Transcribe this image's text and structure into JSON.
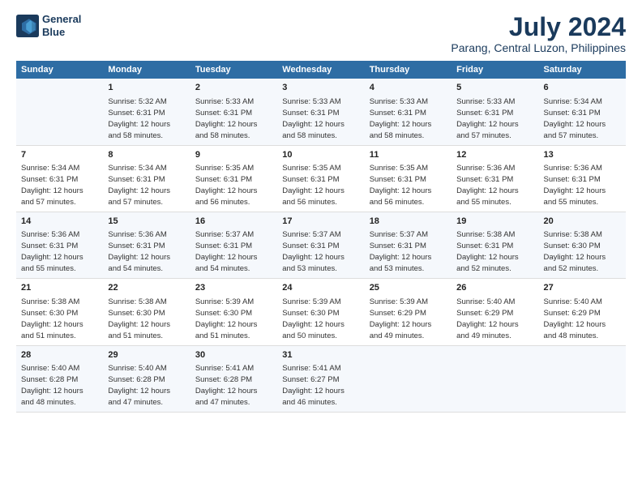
{
  "header": {
    "logo_line1": "General",
    "logo_line2": "Blue",
    "title": "July 2024",
    "subtitle": "Parang, Central Luzon, Philippines"
  },
  "columns": [
    "Sunday",
    "Monday",
    "Tuesday",
    "Wednesday",
    "Thursday",
    "Friday",
    "Saturday"
  ],
  "weeks": [
    {
      "cells": [
        {
          "day": "",
          "info": ""
        },
        {
          "day": "1",
          "info": "Sunrise: 5:32 AM\nSunset: 6:31 PM\nDaylight: 12 hours\nand 58 minutes."
        },
        {
          "day": "2",
          "info": "Sunrise: 5:33 AM\nSunset: 6:31 PM\nDaylight: 12 hours\nand 58 minutes."
        },
        {
          "day": "3",
          "info": "Sunrise: 5:33 AM\nSunset: 6:31 PM\nDaylight: 12 hours\nand 58 minutes."
        },
        {
          "day": "4",
          "info": "Sunrise: 5:33 AM\nSunset: 6:31 PM\nDaylight: 12 hours\nand 58 minutes."
        },
        {
          "day": "5",
          "info": "Sunrise: 5:33 AM\nSunset: 6:31 PM\nDaylight: 12 hours\nand 57 minutes."
        },
        {
          "day": "6",
          "info": "Sunrise: 5:34 AM\nSunset: 6:31 PM\nDaylight: 12 hours\nand 57 minutes."
        }
      ]
    },
    {
      "cells": [
        {
          "day": "7",
          "info": "Sunrise: 5:34 AM\nSunset: 6:31 PM\nDaylight: 12 hours\nand 57 minutes."
        },
        {
          "day": "8",
          "info": "Sunrise: 5:34 AM\nSunset: 6:31 PM\nDaylight: 12 hours\nand 57 minutes."
        },
        {
          "day": "9",
          "info": "Sunrise: 5:35 AM\nSunset: 6:31 PM\nDaylight: 12 hours\nand 56 minutes."
        },
        {
          "day": "10",
          "info": "Sunrise: 5:35 AM\nSunset: 6:31 PM\nDaylight: 12 hours\nand 56 minutes."
        },
        {
          "day": "11",
          "info": "Sunrise: 5:35 AM\nSunset: 6:31 PM\nDaylight: 12 hours\nand 56 minutes."
        },
        {
          "day": "12",
          "info": "Sunrise: 5:36 AM\nSunset: 6:31 PM\nDaylight: 12 hours\nand 55 minutes."
        },
        {
          "day": "13",
          "info": "Sunrise: 5:36 AM\nSunset: 6:31 PM\nDaylight: 12 hours\nand 55 minutes."
        }
      ]
    },
    {
      "cells": [
        {
          "day": "14",
          "info": "Sunrise: 5:36 AM\nSunset: 6:31 PM\nDaylight: 12 hours\nand 55 minutes."
        },
        {
          "day": "15",
          "info": "Sunrise: 5:36 AM\nSunset: 6:31 PM\nDaylight: 12 hours\nand 54 minutes."
        },
        {
          "day": "16",
          "info": "Sunrise: 5:37 AM\nSunset: 6:31 PM\nDaylight: 12 hours\nand 54 minutes."
        },
        {
          "day": "17",
          "info": "Sunrise: 5:37 AM\nSunset: 6:31 PM\nDaylight: 12 hours\nand 53 minutes."
        },
        {
          "day": "18",
          "info": "Sunrise: 5:37 AM\nSunset: 6:31 PM\nDaylight: 12 hours\nand 53 minutes."
        },
        {
          "day": "19",
          "info": "Sunrise: 5:38 AM\nSunset: 6:31 PM\nDaylight: 12 hours\nand 52 minutes."
        },
        {
          "day": "20",
          "info": "Sunrise: 5:38 AM\nSunset: 6:30 PM\nDaylight: 12 hours\nand 52 minutes."
        }
      ]
    },
    {
      "cells": [
        {
          "day": "21",
          "info": "Sunrise: 5:38 AM\nSunset: 6:30 PM\nDaylight: 12 hours\nand 51 minutes."
        },
        {
          "day": "22",
          "info": "Sunrise: 5:38 AM\nSunset: 6:30 PM\nDaylight: 12 hours\nand 51 minutes."
        },
        {
          "day": "23",
          "info": "Sunrise: 5:39 AM\nSunset: 6:30 PM\nDaylight: 12 hours\nand 51 minutes."
        },
        {
          "day": "24",
          "info": "Sunrise: 5:39 AM\nSunset: 6:30 PM\nDaylight: 12 hours\nand 50 minutes."
        },
        {
          "day": "25",
          "info": "Sunrise: 5:39 AM\nSunset: 6:29 PM\nDaylight: 12 hours\nand 49 minutes."
        },
        {
          "day": "26",
          "info": "Sunrise: 5:40 AM\nSunset: 6:29 PM\nDaylight: 12 hours\nand 49 minutes."
        },
        {
          "day": "27",
          "info": "Sunrise: 5:40 AM\nSunset: 6:29 PM\nDaylight: 12 hours\nand 48 minutes."
        }
      ]
    },
    {
      "cells": [
        {
          "day": "28",
          "info": "Sunrise: 5:40 AM\nSunset: 6:28 PM\nDaylight: 12 hours\nand 48 minutes."
        },
        {
          "day": "29",
          "info": "Sunrise: 5:40 AM\nSunset: 6:28 PM\nDaylight: 12 hours\nand 47 minutes."
        },
        {
          "day": "30",
          "info": "Sunrise: 5:41 AM\nSunset: 6:28 PM\nDaylight: 12 hours\nand 47 minutes."
        },
        {
          "day": "31",
          "info": "Sunrise: 5:41 AM\nSunset: 6:27 PM\nDaylight: 12 hours\nand 46 minutes."
        },
        {
          "day": "",
          "info": ""
        },
        {
          "day": "",
          "info": ""
        },
        {
          "day": "",
          "info": ""
        }
      ]
    }
  ]
}
